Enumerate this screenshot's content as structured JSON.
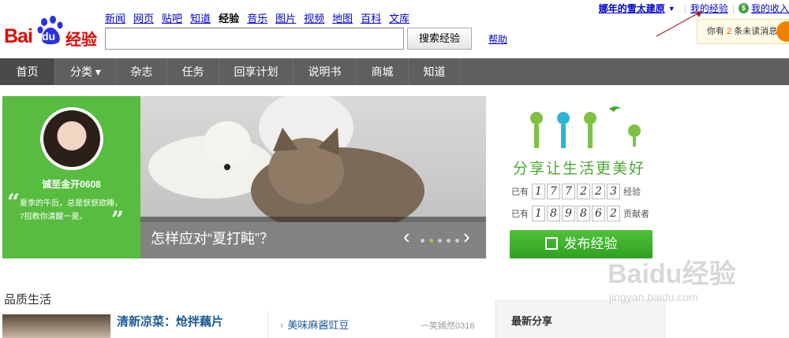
{
  "logo": {
    "bai": "Bai",
    "du": "du",
    "suffix": "经验"
  },
  "topnav": [
    {
      "label": "新闻",
      "current": false
    },
    {
      "label": "网页",
      "current": false
    },
    {
      "label": "贴吧",
      "current": false
    },
    {
      "label": "知道",
      "current": false
    },
    {
      "label": "经验",
      "current": true
    },
    {
      "label": "音乐",
      "current": false
    },
    {
      "label": "图片",
      "current": false
    },
    {
      "label": "视频",
      "current": false
    },
    {
      "label": "地图",
      "current": false
    },
    {
      "label": "百科",
      "current": false
    },
    {
      "label": "文库",
      "current": false
    }
  ],
  "search": {
    "value": "",
    "button": "搜索经验",
    "help": "帮助"
  },
  "user": {
    "name": "娜年的雪太建原",
    "my_experience": "我的经验",
    "my_income": "我的收入"
  },
  "notice": {
    "prefix": "你有 ",
    "count": "2",
    "suffix": " 条未读消息"
  },
  "navbar": [
    {
      "label": "首页"
    },
    {
      "label": "分类 ▾"
    },
    {
      "label": "杂志"
    },
    {
      "label": "任务"
    },
    {
      "label": "回享计划"
    },
    {
      "label": "说明书"
    },
    {
      "label": "商城"
    },
    {
      "label": "知道"
    }
  ],
  "banner": {
    "author": "诚至金开0608",
    "quote": "夏季的午后，总是恹恹欲睡，7招教你清醒一夏。",
    "caption": "怎样应对“夏打盹”？",
    "prev": "‹",
    "next": "›"
  },
  "stats": {
    "slogan": "分享让生活更美好",
    "row1_prefix": "已有",
    "row1_digits": [
      "1",
      "7",
      "7",
      "2",
      "2",
      "3"
    ],
    "row1_suffix": "经验",
    "row2_prefix": "已有",
    "row2_digits": [
      "1",
      "8",
      "9",
      "8",
      "6",
      "2"
    ],
    "row2_suffix": "贡献者",
    "publish": "发布经验"
  },
  "section": {
    "title": "品质生活",
    "article_title": "清新凉菜：炝拌藕片",
    "list_item": "美味麻酱豇豆",
    "list_author": "一笑嫣然0316",
    "recent_title": "最新分享"
  },
  "watermark": {
    "line1": "Baidu经验",
    "line2": "jingyan.baidu.com"
  },
  "colors": {
    "brand_red": "#e10602",
    "nav_bg": "#5f5f5f",
    "green": "#57bc3f",
    "link": "#0000cc"
  }
}
